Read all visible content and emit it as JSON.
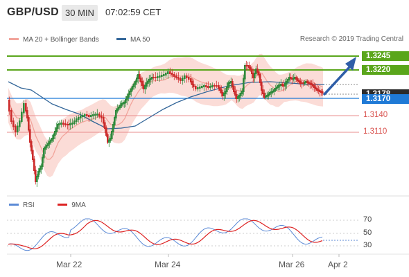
{
  "header": {
    "symbol": "GBP/USD",
    "timeframe": "30 MIN",
    "time": "07:02:59 CET"
  },
  "legend": {
    "bollinger": "MA 20 + Bollinger Bands",
    "ma50": "MA 50",
    "copyright": "Research © 2019 Trading Central"
  },
  "levels": {
    "green_top": "1.3245",
    "green_mid": "1.3220",
    "current_price": "1.3178",
    "pivot": "1.3170",
    "red_1": "1.3140",
    "red_2": "1.3110"
  },
  "rsi_panel": {
    "rsi_label": "RSI",
    "ma_label": "9MA",
    "axis": [
      "70",
      "50",
      "30"
    ]
  },
  "dates": [
    "Mar 22",
    "Mar 24",
    "Mar 26",
    "Apr 2"
  ],
  "colors": {
    "up_candle": "#2f8a3c",
    "down_candle": "#cc2b2b",
    "bollinger_band": "#fbdcd7",
    "ma20": "#f2a49b",
    "ma50": "#336699",
    "green_level": "#5aa61b",
    "red_level": "#e88c8c",
    "pivot_level": "#1f7ad6",
    "arrow": "#2f5ea8",
    "rsi_line": "#5b8ad6",
    "rsi_ma": "#dd2222"
  },
  "icons": [
    "trend-arrow-icon"
  ]
}
